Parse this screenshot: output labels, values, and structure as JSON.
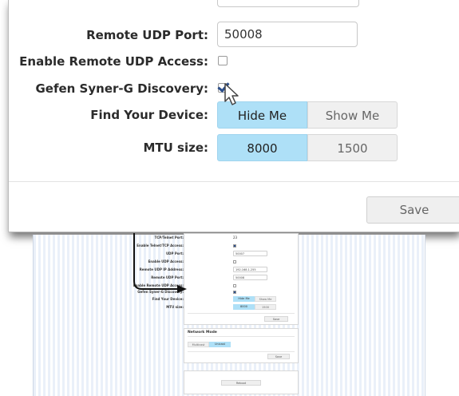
{
  "zoom": {
    "remote_udp_port": {
      "label": "Remote UDP Port:",
      "value": "50008"
    },
    "enable_remote_udp_access": {
      "label": "Enable Remote UDP Access:",
      "checked": false
    },
    "syner_g_discovery": {
      "label": "Gefen Syner-G Discovery:",
      "checked": true
    },
    "find_your_device": {
      "label": "Find Your Device:",
      "options": [
        "Hide Me",
        "Show Me"
      ],
      "selected": "Hide Me"
    },
    "mtu_size": {
      "label": "MTU size:",
      "options": [
        "8000",
        "1500"
      ],
      "selected": "8000"
    },
    "save_label": "Save"
  },
  "mini": {
    "rows": [
      {
        "label": "TCP/Telnet Port:",
        "value": "23"
      },
      {
        "label": "Enable Telnet/TCP Access:"
      },
      {
        "label": "UDP Port:",
        "value": "50007"
      },
      {
        "label": "Enable UDP Access:"
      },
      {
        "label": "Remote UDP IP Address:",
        "value": "192.168.1.255"
      },
      {
        "label": "Remote UDP Port:",
        "value": "50008"
      },
      {
        "label": "Enable Remote UDP Access:"
      },
      {
        "label": "Gefen Syner-G Discovery:"
      },
      {
        "label": "Find Your Device:",
        "options": [
          "Hide Me",
          "Show Me"
        ]
      },
      {
        "label": "MTU size:",
        "options": [
          "8000",
          "1500"
        ]
      }
    ],
    "save_label": "Save",
    "network_mode": {
      "heading": "Network Mode",
      "options": [
        "Multicast",
        "Unicast"
      ],
      "selected": "Unicast"
    },
    "save2_label": "Save",
    "reboot_label": "Reboot"
  },
  "colors": {
    "active_segment": "#aee0f7",
    "check_blue": "#2a4d8a",
    "page_stripes": "#eaf0f9"
  }
}
